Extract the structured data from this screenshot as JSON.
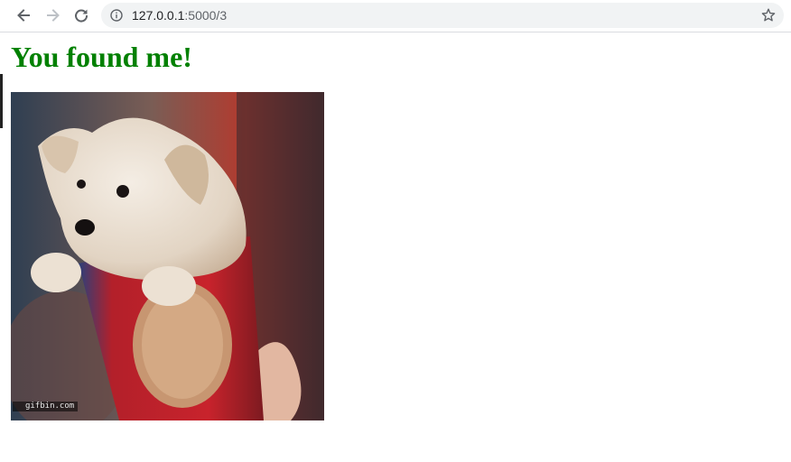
{
  "browser": {
    "url_host": "127.0.0.1",
    "url_path": ":5000/3",
    "icons": {
      "back": "arrow-left",
      "forward": "arrow-right",
      "reload": "circular-arrow",
      "site_info": "info-circle",
      "bookmark": "star-outline"
    }
  },
  "page": {
    "heading": "You found me!",
    "heading_color": "#008000",
    "image": {
      "subject": "puppy in a cup",
      "watermark": "gifbin.com"
    }
  }
}
